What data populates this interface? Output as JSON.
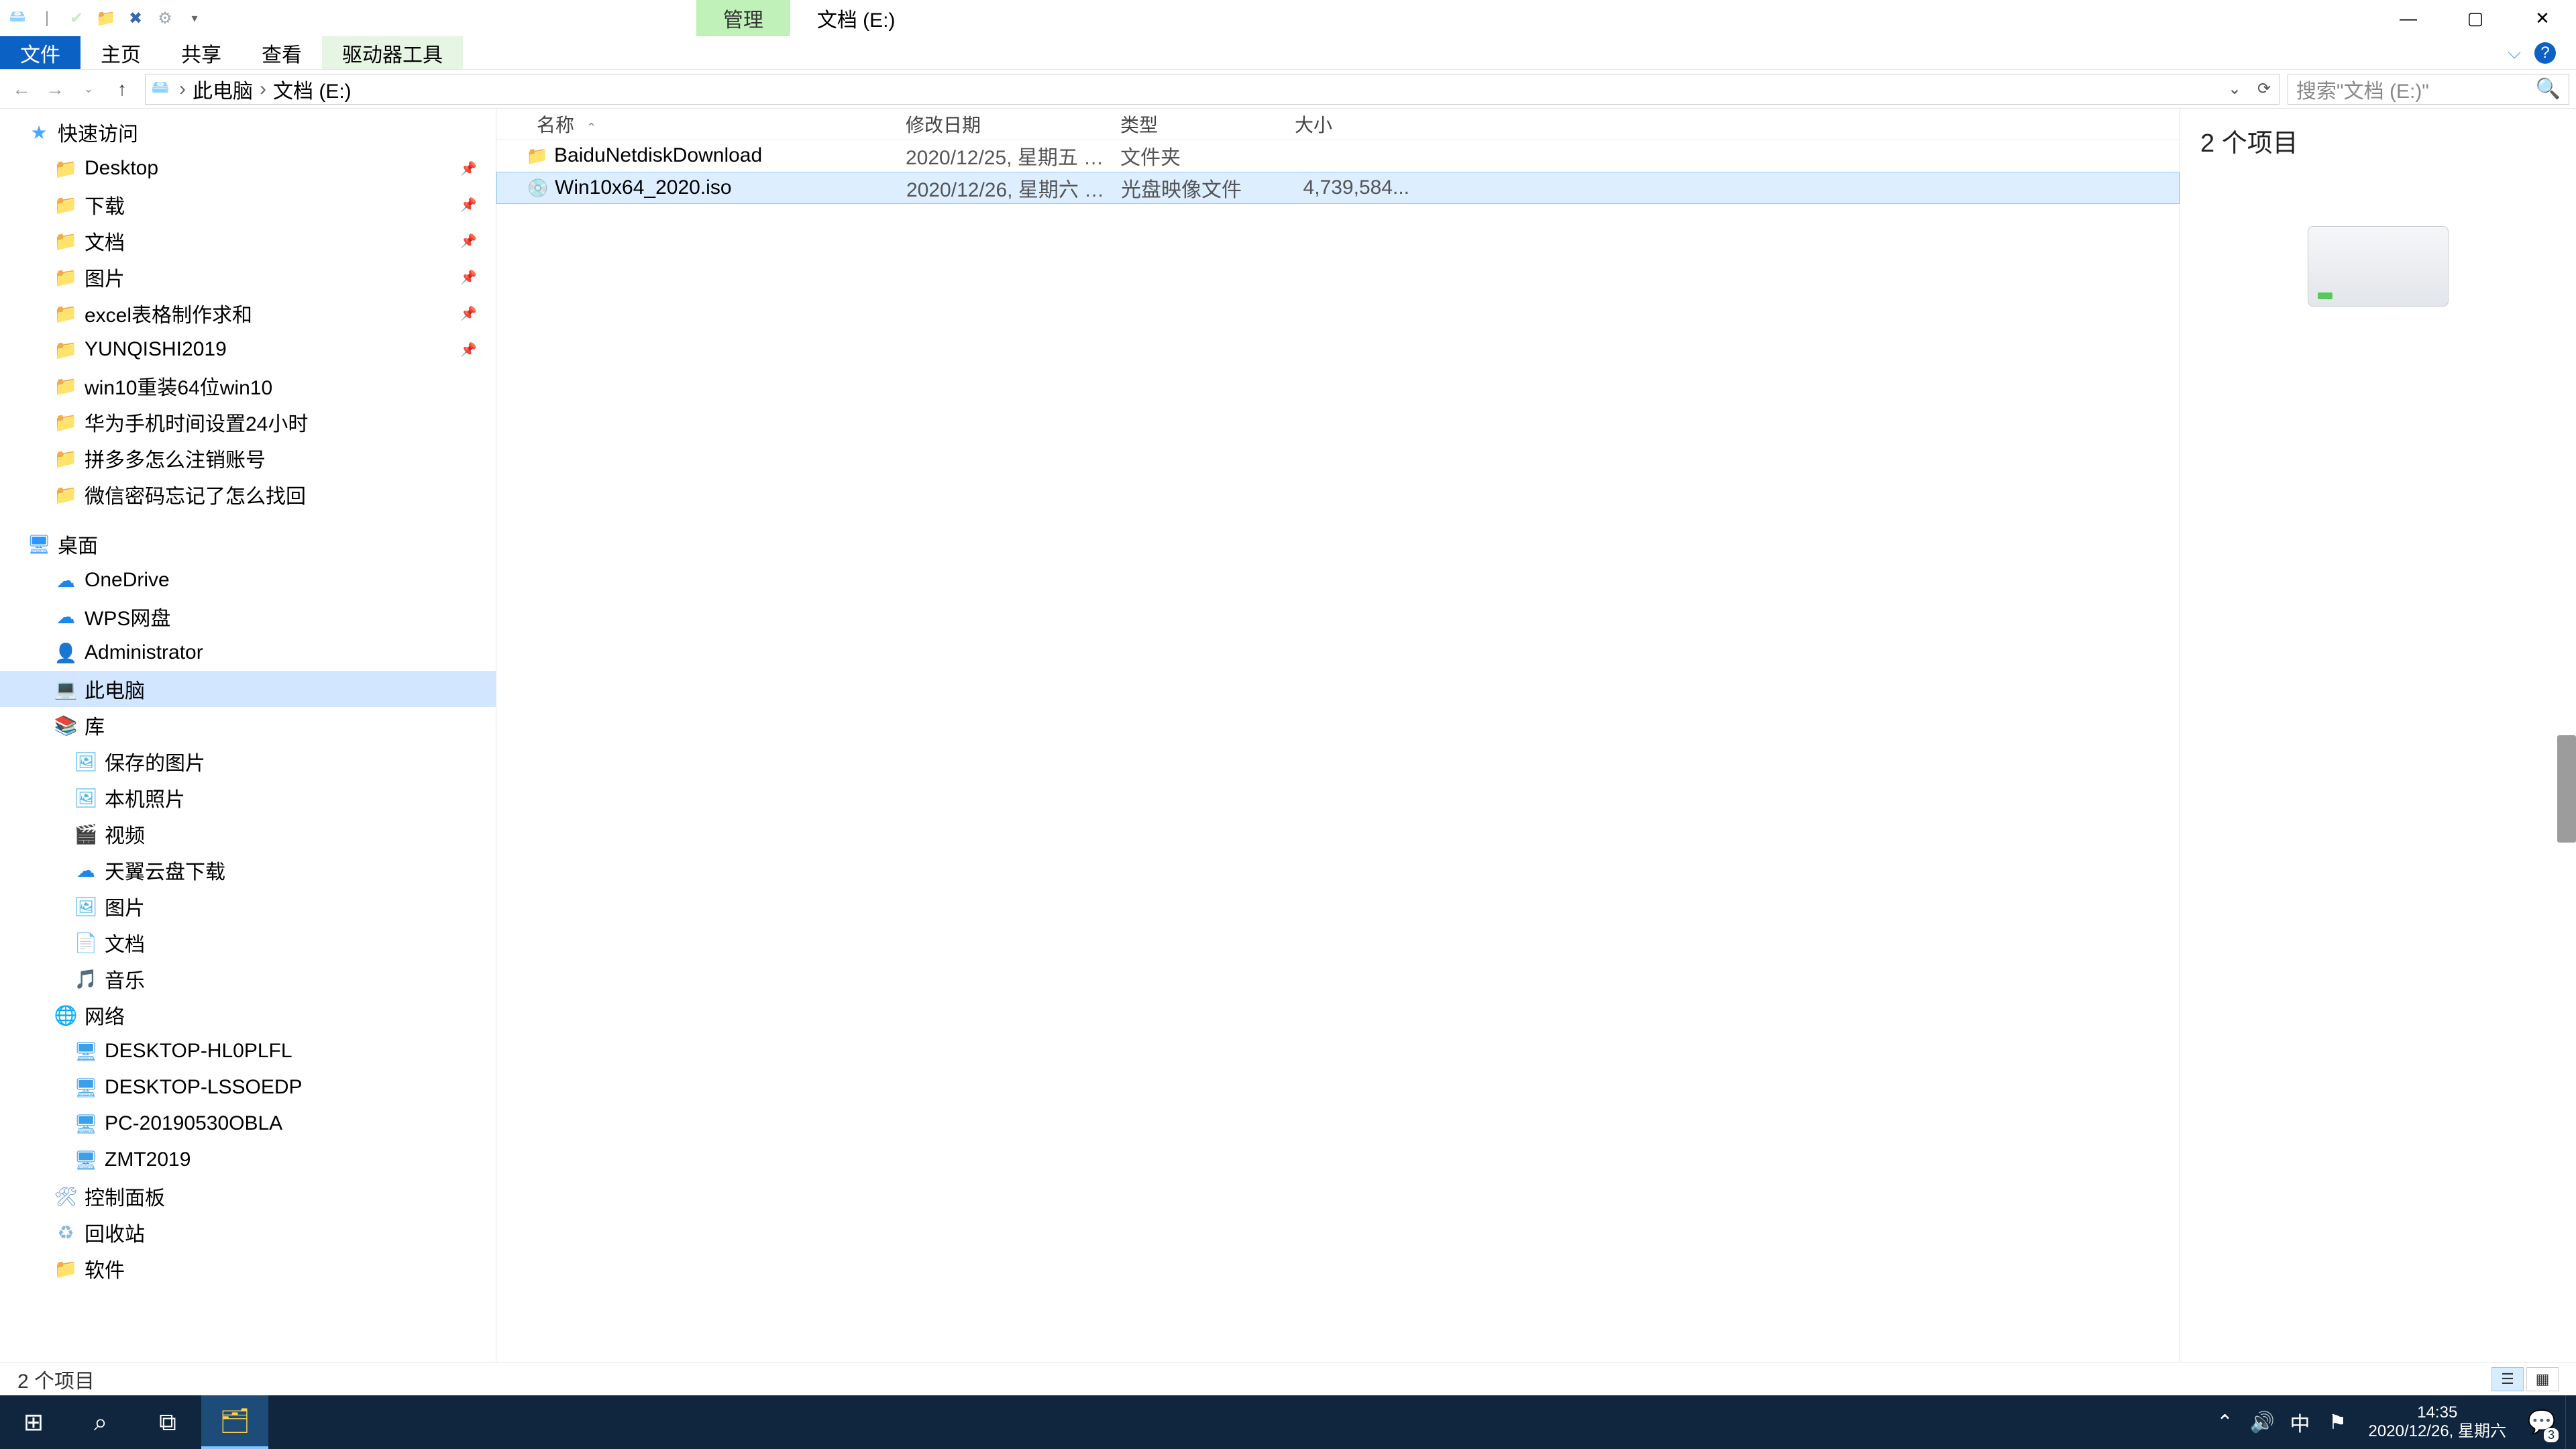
{
  "ribbon": {
    "ctx_manage": "管理",
    "ctx_title": "文档 (E:)"
  },
  "menu": {
    "file": "文件",
    "home": "主页",
    "share": "共享",
    "view": "查看",
    "driver": "驱动器工具"
  },
  "breadcrumb": {
    "root": "此电脑",
    "leaf": "文档 (E:)",
    "sep": "›"
  },
  "search": {
    "placeholder": "搜索\"文档 (E:)\""
  },
  "sidebar": {
    "quick": "快速访问",
    "q_items": [
      "Desktop",
      "下载",
      "文档",
      "图片",
      "excel表格制作求和",
      "YUNQISHI2019",
      "win10重装64位win10",
      "华为手机时间设置24小时",
      "拼多多怎么注销账号",
      "微信密码忘记了怎么找回"
    ],
    "desktop": "桌面",
    "d_items": [
      "OneDrive",
      "WPS网盘",
      "Administrator",
      "此电脑",
      "库",
      "保存的图片",
      "本机照片",
      "视频",
      "天翼云盘下载",
      "图片",
      "文档",
      "音乐",
      "网络",
      "DESKTOP-HL0PLFL",
      "DESKTOP-LSSOEDP",
      "PC-20190530OBLA",
      "ZMT2019",
      "控制面板",
      "回收站",
      "软件"
    ]
  },
  "columns": {
    "name": "名称",
    "date": "修改日期",
    "type": "类型",
    "size": "大小"
  },
  "rows": [
    {
      "name": "BaiduNetdiskDownload",
      "date": "2020/12/25, 星期五 1...",
      "type": "文件夹",
      "size": "",
      "icon": "folder"
    },
    {
      "name": "Win10x64_2020.iso",
      "date": "2020/12/26, 星期六 1...",
      "type": "光盘映像文件",
      "size": "4,739,584...",
      "icon": "iso",
      "selected": true
    }
  ],
  "details": {
    "count": "2 个项目"
  },
  "status": {
    "count": "2 个项目"
  },
  "clock": {
    "time": "14:35",
    "date": "2020/12/26, 星期六"
  },
  "ime": "中",
  "notif_badge": "3"
}
